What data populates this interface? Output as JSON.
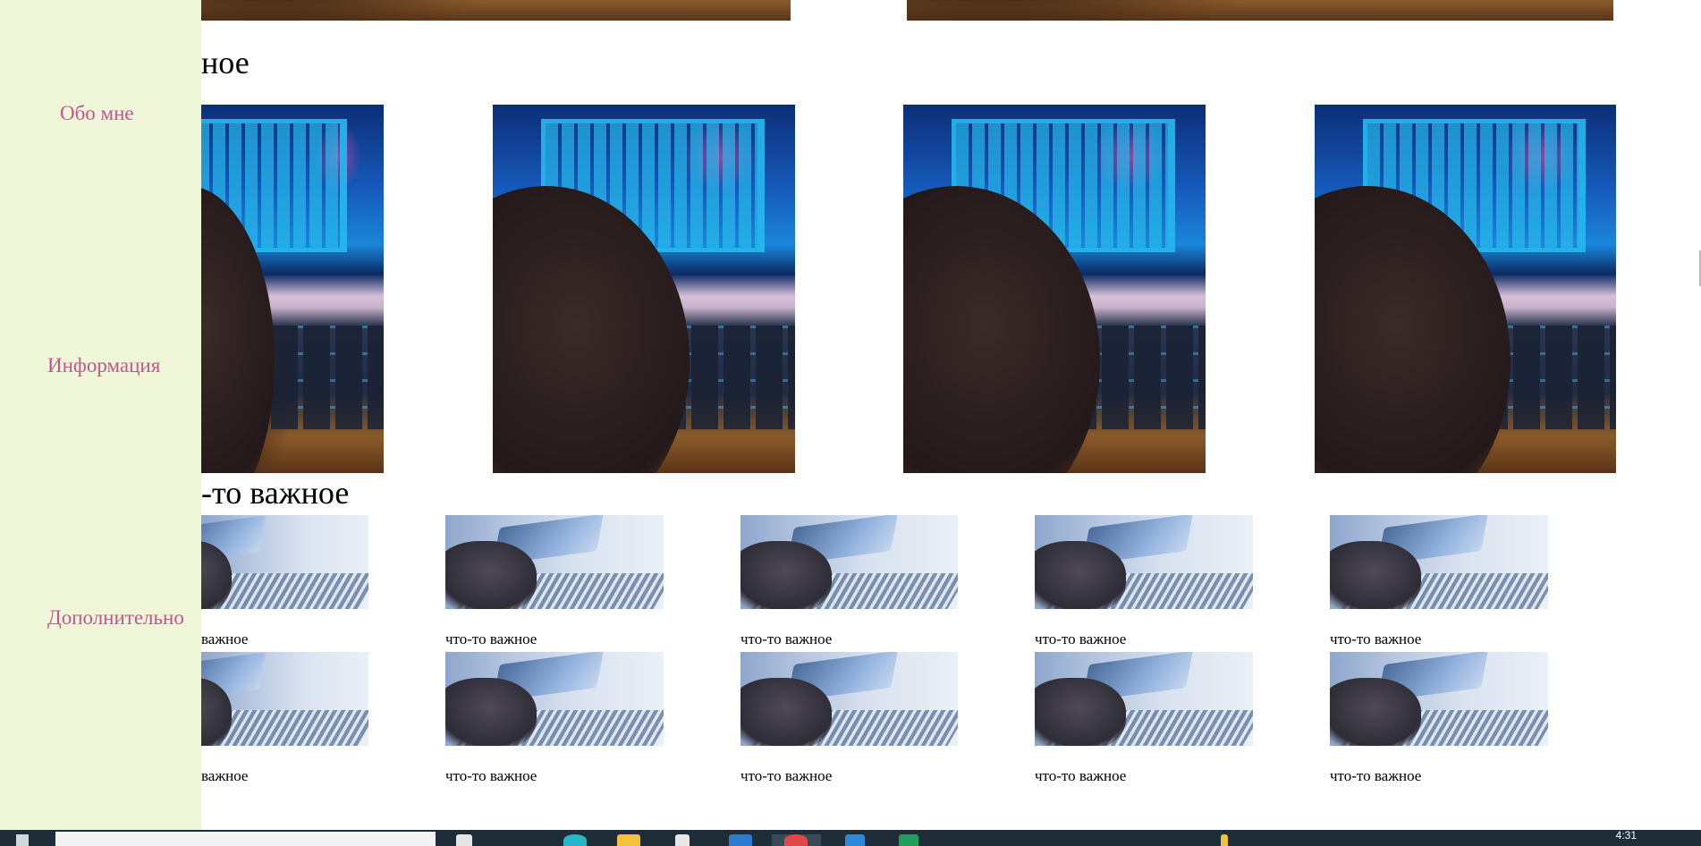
{
  "sidebar": {
    "items": [
      {
        "label": "Обо мне"
      },
      {
        "label": "Информация"
      },
      {
        "label": "Дополнительно"
      }
    ]
  },
  "sections": {
    "heading_1": "ное",
    "heading_2": "-то важное"
  },
  "gallery": {
    "captions_row_1": [
      "важное",
      "что-то важное",
      "что-то важное",
      "что-то важное",
      "что-то важное"
    ],
    "captions_row_2": [
      "важное",
      "что-то важное",
      "что-то важное",
      "что-то важное",
      "что-то важное"
    ]
  },
  "taskbar": {
    "clock": "4:31"
  },
  "colors": {
    "sidebar_bg": "#f0f6d8",
    "nav_link": "#c2578f",
    "taskbar_bg": "#1f2d38"
  }
}
